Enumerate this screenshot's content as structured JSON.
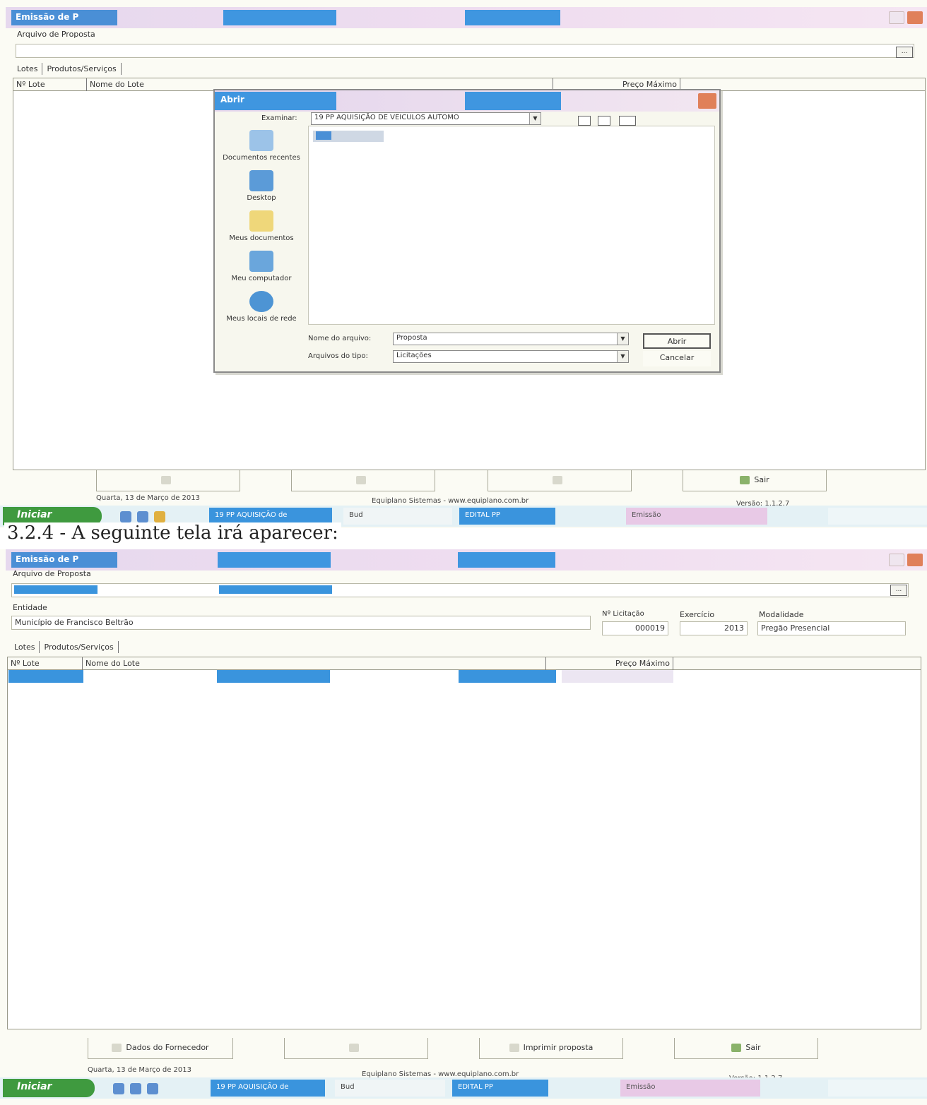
{
  "top": {
    "window_title": "Emissão de P",
    "proposal_file_label": "Arquivo de Proposta",
    "proposal_file_value": "",
    "browse_label": "...",
    "tabs": [
      "Lotes",
      "Produtos/Serviços"
    ],
    "columns": [
      "Nº Lote",
      "Nome do Lote",
      "Preço Máximo"
    ],
    "buttons": {
      "supplier_data": "",
      "blank": "",
      "print": "",
      "exit": "Sair"
    },
    "status": {
      "date": "Quarta, 13 de Março de 2013",
      "company": "Equiplano Sistemas - www.equiplano.com.br",
      "version": "Versão: 1.1.2.7"
    },
    "taskbar": {
      "start": "Iniciar",
      "tasks": [
        "19 PP AQUISIÇÃO de",
        "Bud",
        "EDITAL PP",
        "Emissão"
      ]
    },
    "dialog": {
      "title": "Abrir",
      "look_in_label": "Examinar:",
      "look_in_value": "19 PP AQUISIÇÃO DE VEICULOS AUTOMO",
      "places": [
        "Documentos recentes",
        "Desktop",
        "Meus documentos",
        "Meu computador",
        "Meus locais de rede"
      ],
      "file_item": "",
      "file_name_label": "Nome do arquivo:",
      "file_name_value": "Proposta",
      "file_type_label": "Arquivos do tipo:",
      "file_type_value": "Licitações",
      "open_button": "Abrir",
      "cancel_button": "Cancelar"
    }
  },
  "heading": "3.2.4 - A seguinte tela irá aparecer:",
  "bottom": {
    "window_title": "Emissão de P",
    "proposal_file_label": "Arquivo de Proposta",
    "proposal_file_value": "",
    "browse_label": "...",
    "entity_label": "Entidade",
    "entity_value": "Município de Francisco Beltrão",
    "licitacao_label": "Nº Licitação",
    "licitacao_value": "000019",
    "exercicio_label": "Exercício",
    "exercicio_value": "2013",
    "modalidade_label": "Modalidade",
    "modalidade_value": "Pregão Presencial",
    "tabs": [
      "Lotes",
      "Produtos/Serviços"
    ],
    "columns": [
      "Nº Lote",
      "Nome do Lote",
      "Preço Máximo"
    ],
    "selected_row": {
      "lote": "",
      "nome": "",
      "preco": ""
    },
    "buttons": {
      "supplier_data": "Dados do Fornecedor",
      "blank": "",
      "print": "Imprimir proposta",
      "exit": "Sair"
    },
    "status": {
      "date": "Quarta, 13 de Março de 2013",
      "company": "Equiplano Sistemas - www.equiplano.com.br",
      "version": "Versão: 1.1.2.7"
    },
    "taskbar": {
      "start": "Iniciar",
      "tasks": [
        "19 PP AQUISIÇÃO de",
        "Bud",
        "EDITAL PP",
        "Emissão"
      ]
    }
  }
}
